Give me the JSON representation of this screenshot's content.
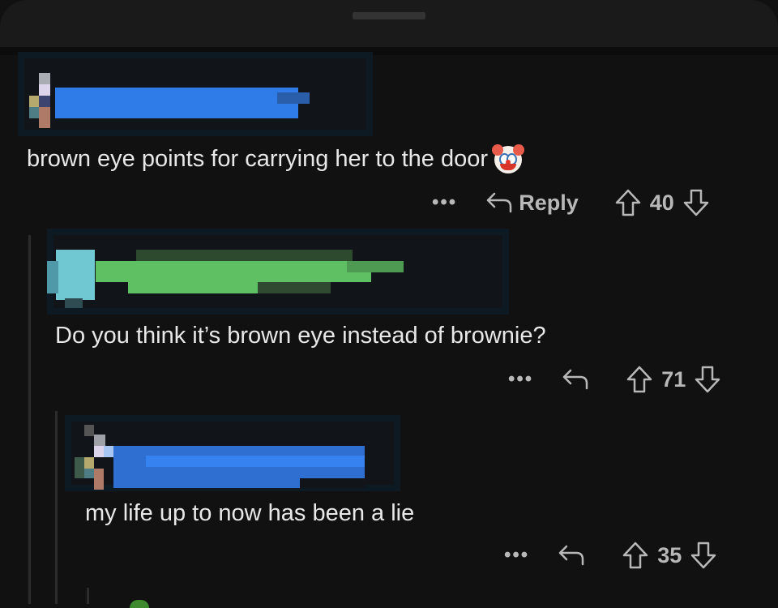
{
  "sheet": {
    "handle": "drag-handle"
  },
  "comments": [
    {
      "id": "c1",
      "username_censored": true,
      "avatar_censored": true,
      "body": "brown eye points for carrying her to the door",
      "emoji": "clown-face",
      "more_label": "•••",
      "reply_label": "Reply",
      "votes": "40",
      "accent": "#2f7be8"
    },
    {
      "id": "c2",
      "username_censored": true,
      "avatar_censored": true,
      "body": "Do you think it’s brown eye instead of brownie?",
      "more_label": "•••",
      "reply_label": "",
      "votes": "71",
      "accent": "#5ec062"
    },
    {
      "id": "c3",
      "username_censored": true,
      "avatar_censored": true,
      "body": "my life up to now has been a lie",
      "more_label": "•••",
      "reply_label": "",
      "votes": "35",
      "accent": "#2f7be8"
    }
  ]
}
